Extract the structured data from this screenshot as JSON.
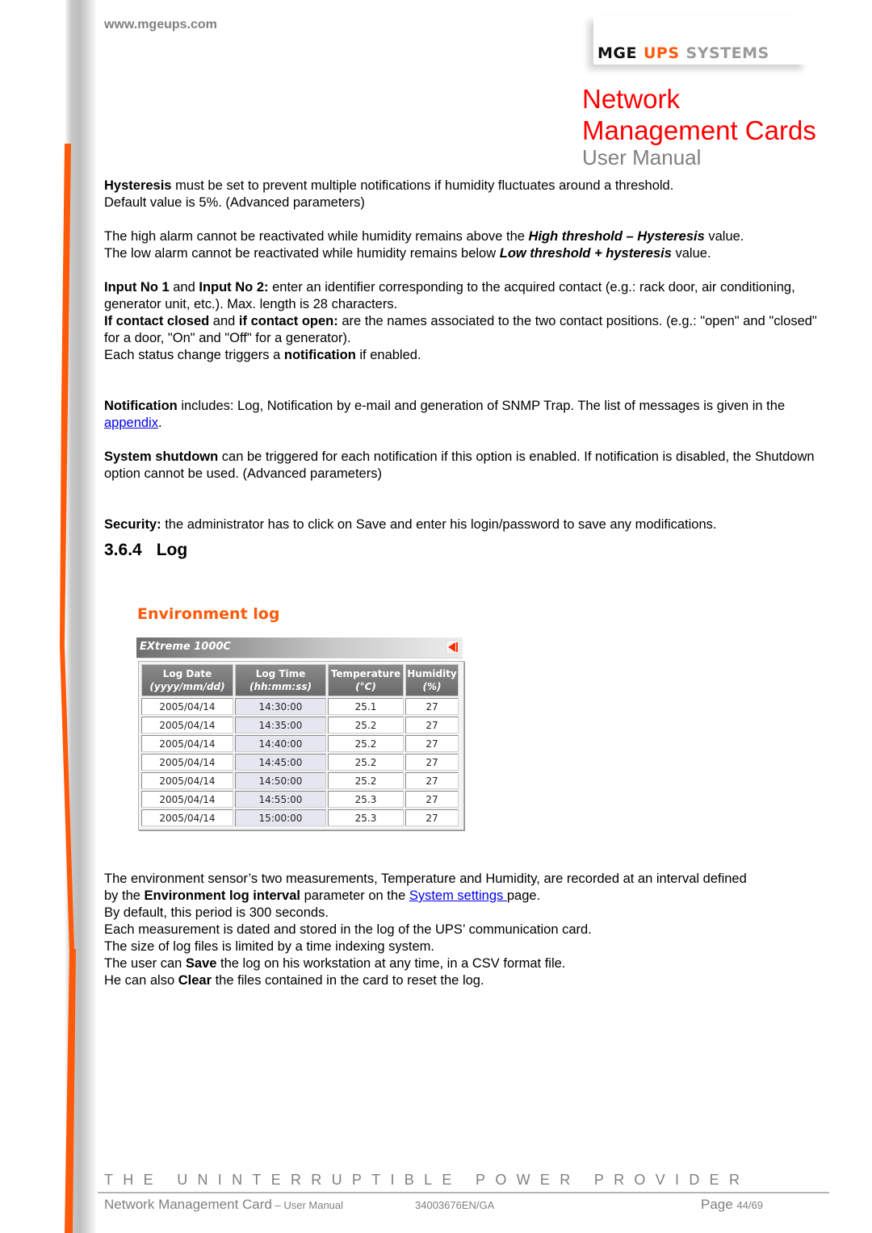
{
  "header": {
    "site_url": "www.mgeups.com",
    "logo": {
      "part1": "MGE",
      "part2": "UPS",
      "part3": "SYSTEMS"
    },
    "title_line1": "Network",
    "title_line2": "Management Cards",
    "subtitle": "User Manual"
  },
  "colors": {
    "accent_orange": "#ff5a0a",
    "title_red": "#ff0000",
    "link_blue": "#0000ee",
    "gray_text": "#808080"
  },
  "body": {
    "p1": {
      "bold": "Hysteresis",
      "text": " must be set to prevent multiple notifications if humidity fluctuates around a threshold.",
      "line2": "Default value is 5%. (Advanced parameters)"
    },
    "p2": {
      "l1_a": "The high alarm cannot be reactivated while humidity remains above the ",
      "l1_b": "High threshold – Hysteresis",
      "l1_c": " value.",
      "l2_a": "The low alarm cannot be reactivated while humidity remains below ",
      "l2_b": "Low threshold + hysteresis",
      "l2_c": "  value."
    },
    "p3": {
      "b1": "Input No 1",
      "t1": " and ",
      "b2": "Input No 2:",
      "t2": " enter an identifier corresponding to the acquired contact (e.g.: rack door, air conditioning, generator unit, etc.). Max. length is 28 characters.",
      "b3": " If contact closed",
      "t3": " and ",
      "b4": "if contact open:",
      "t4": " are the names associated to the two contact positions. (e.g.: \"open\" and \"closed\" for a door, \"On\" and \"Off\" for a generator).",
      "t5": "Each status change triggers a ",
      "b5": "notification",
      "t6": " if enabled."
    },
    "p4": {
      "bold": "Notification",
      "text": " includes: Log, Notification by e-mail and generation of SNMP Trap. The list of messages is given in the ",
      "link": "appendix",
      "end": "."
    },
    "p5": {
      "bold": "System shutdown",
      "text": " can be triggered for each notification if this option is enabled. If notification is disabled, the Shutdown option cannot be used. (Advanced parameters)"
    },
    "p6": {
      "bold": "Security:",
      "text": " the administrator has to click on Save and enter his login/password to save any modifications."
    }
  },
  "section": {
    "number": "3.6.4",
    "title": "Log"
  },
  "env_log": {
    "title": "Environment log",
    "device_name": "EXtreme 1000C",
    "back_icon": "back-arrow-icon",
    "columns": [
      {
        "label": "Log Date",
        "unit": "(yyyy/mm/dd)"
      },
      {
        "label": "Log Time",
        "unit": "(hh:mm:ss)"
      },
      {
        "label": "Temperature",
        "unit": "(°C)"
      },
      {
        "label": "Humidity",
        "unit": "(%)"
      }
    ],
    "rows": [
      [
        "2005/04/14",
        "14:30:00",
        "25.1",
        "27"
      ],
      [
        "2005/04/14",
        "14:35:00",
        "25.2",
        "27"
      ],
      [
        "2005/04/14",
        "14:40:00",
        "25.2",
        "27"
      ],
      [
        "2005/04/14",
        "14:45:00",
        "25.2",
        "27"
      ],
      [
        "2005/04/14",
        "14:50:00",
        "25.2",
        "27"
      ],
      [
        "2005/04/14",
        "14:55:00",
        "25.3",
        "27"
      ],
      [
        "2005/04/14",
        "15:00:00",
        "25.3",
        "27"
      ]
    ]
  },
  "body2": {
    "l1": "The environment sensor’s two measurements, Temperature and Humidity, are recorded at an interval defined",
    "l2_a": "by the ",
    "l2_b": "Environment log interval",
    "l2_c": " parameter on the ",
    "l2_link": "System settings ",
    "l2_d": " page.",
    "l3": "By default, this period is 300 seconds.",
    "l4": "Each measurement is dated and stored in the log of the UPS’ communication card.",
    "l5": "The size of log files is limited by a time indexing system.",
    "l6_a": "The user can ",
    "l6_b": "Save",
    "l6_c": " the log on his workstation at any time, in a CSV format file.",
    "l7_a": "He can also ",
    "l7_b": "Clear",
    "l7_c": " the files contained in the card to reset the log."
  },
  "footer": {
    "tagline": "THE UNINTERRUPTIBLE POWER PROVIDER",
    "doc_title": "Network Management Card",
    "doc_sub": " – User Manual",
    "doc_code": "34003676EN/GA",
    "page_label": "Page ",
    "page_value": "44/69"
  }
}
